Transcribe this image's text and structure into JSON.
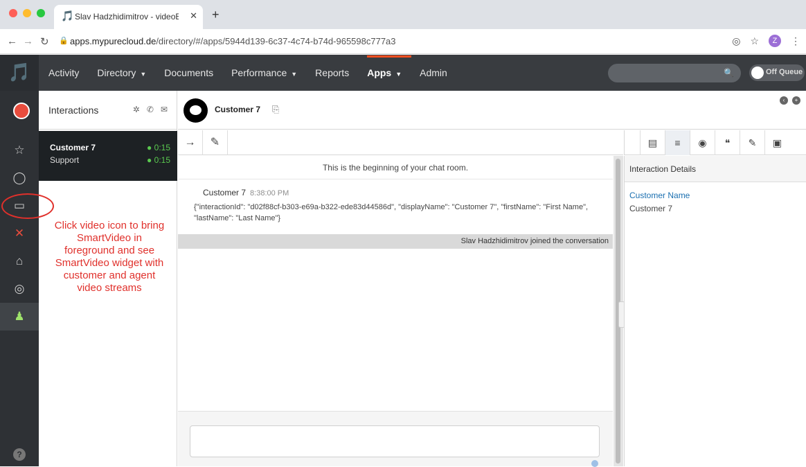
{
  "browser": {
    "tab_title": "Slav Hadzhidimitrov - videoEng",
    "url_domain": "apps.mypurecloud.de",
    "url_path": "/directory/#/apps/5944d139-6c37-4c74-b74d-965598c777a3",
    "profile_initial": "Z"
  },
  "nav": {
    "items": [
      "Activity",
      "Directory",
      "Documents",
      "Performance",
      "Reports",
      "Apps",
      "Admin"
    ],
    "active": "Apps",
    "queue_label": "Off Queue"
  },
  "interactions": {
    "title": "Interactions",
    "item": {
      "name": "Customer 7",
      "queue": "Support",
      "time1": "0:15",
      "time2": "0:15"
    }
  },
  "annotation": {
    "text": "Click video icon to bring SmartVideo in foreground and see SmartVideo widget with customer and agent video streams",
    "color": "#e0302b"
  },
  "conversation": {
    "name": "Customer 7",
    "begin_text": "This is the beginning of your chat room.",
    "message_author": "Customer 7",
    "message_time": "8:38:00 PM",
    "message_body": "{\"interactionId\": \"d02f88cf-b303-e69a-b322-ede83d44586d\", \"displayName\": \"Customer 7\", \"firstName\": \"First Name\", \"lastName\": \"Last Name\"}",
    "joined_text": "Slav Hadzhidimitrov joined the conversation"
  },
  "details": {
    "header": "Interaction Details",
    "field_label": "Customer Name",
    "field_value": "Customer 7"
  },
  "colors": {
    "brand": "#ff4f1f",
    "active_time": "#5ac94f",
    "link": "#1a6fb0"
  }
}
